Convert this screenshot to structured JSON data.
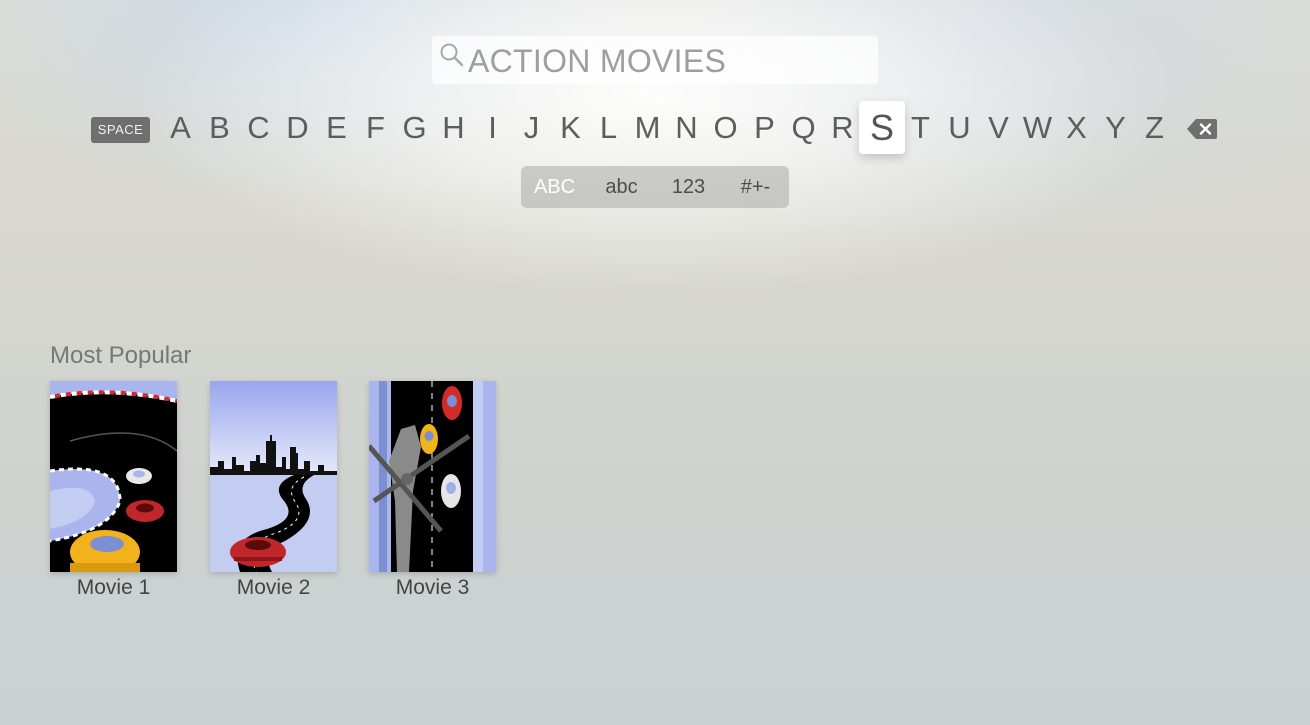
{
  "search": {
    "query": "ACTION MOVIES"
  },
  "keyboard": {
    "space_label": "SPACE",
    "letters": [
      "A",
      "B",
      "C",
      "D",
      "E",
      "F",
      "G",
      "H",
      "I",
      "J",
      "K",
      "L",
      "M",
      "N",
      "O",
      "P",
      "Q",
      "R",
      "S",
      "T",
      "U",
      "V",
      "W",
      "X",
      "Y",
      "Z"
    ],
    "focused_letter": "S",
    "modes": [
      "ABC",
      "abc",
      "123",
      "#+-"
    ],
    "active_mode": "ABC"
  },
  "results": {
    "section_title": "Most Popular",
    "movies": [
      {
        "title": "Movie 1"
      },
      {
        "title": "Movie 2"
      },
      {
        "title": "Movie 3"
      }
    ]
  },
  "colors": {
    "accent_red": "#d32a2a",
    "accent_yellow": "#f2b21b",
    "poster_lavender": "#a9b5ec"
  }
}
